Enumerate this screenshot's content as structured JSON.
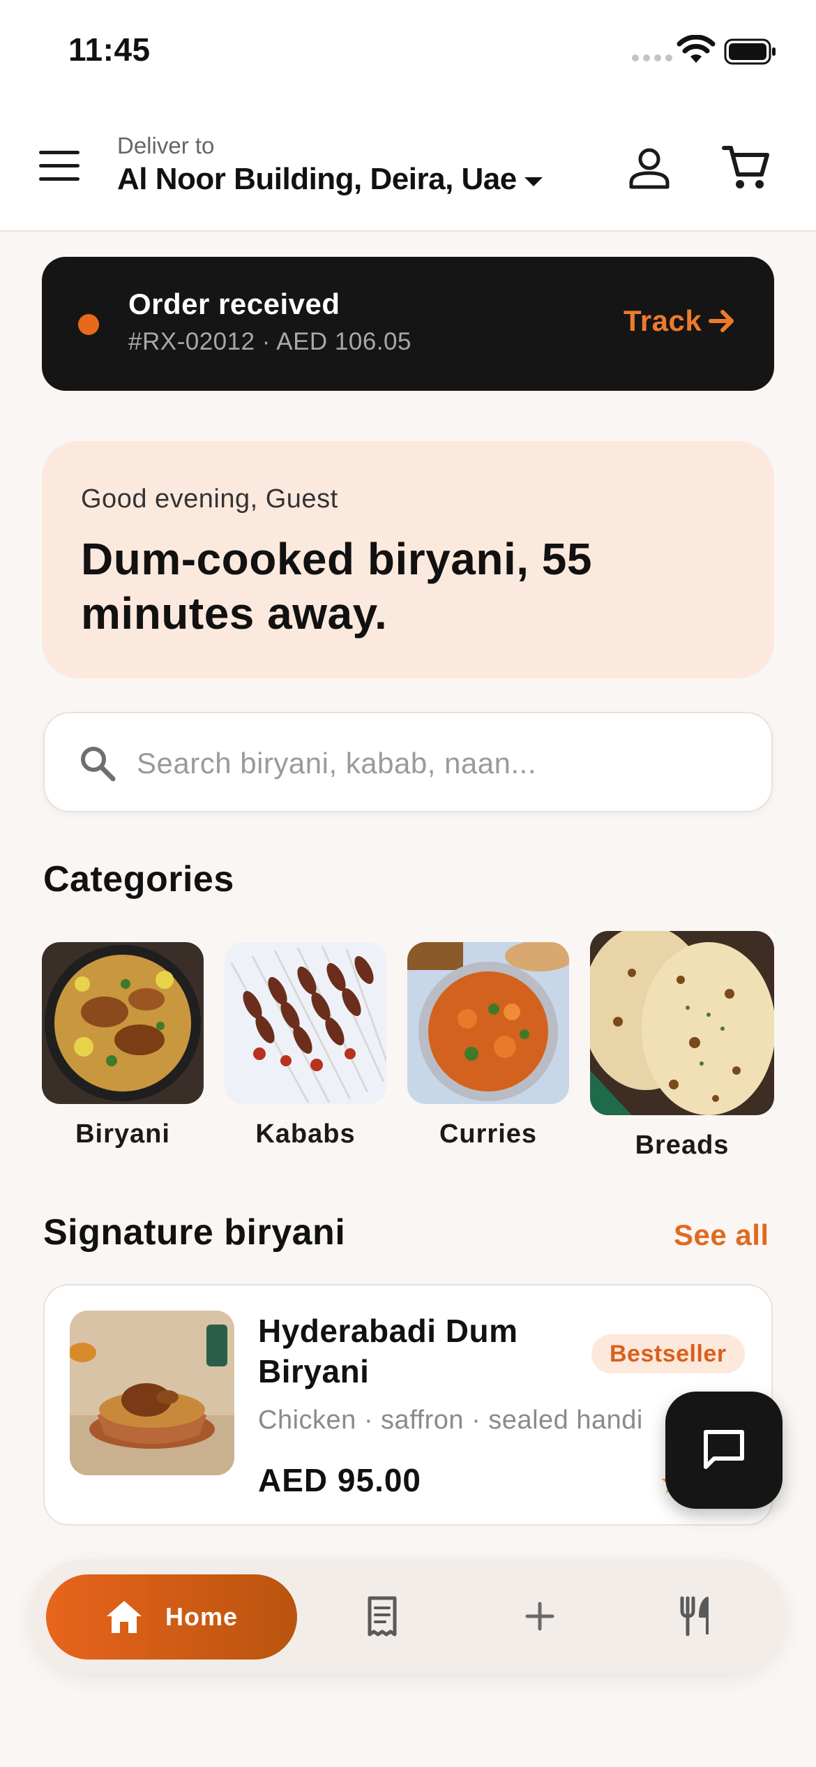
{
  "status_bar": {
    "time": "11:45"
  },
  "header": {
    "deliver_label": "Deliver to",
    "address": "Al Noor Building, Deira, Uae"
  },
  "order_banner": {
    "title": "Order received",
    "meta": "#RX-02012 · AED 106.05",
    "track_label": "Track",
    "status_color": "#e9691c"
  },
  "greeting": {
    "subtitle": "Good evening, Guest",
    "headline": "Dum-cooked biryani, 55 minutes away."
  },
  "search": {
    "placeholder": "Search biryani, kabab, naan..."
  },
  "categories": {
    "title": "Categories",
    "items": [
      {
        "label": "Biryani"
      },
      {
        "label": "Kababs"
      },
      {
        "label": "Curries"
      },
      {
        "label": "Breads"
      }
    ]
  },
  "signature": {
    "title": "Signature biryani",
    "see_all_label": "See all",
    "product": {
      "name": "Hyderabadi Dum Biryani",
      "badge": "Bestseller",
      "description": "Chicken · saffron · sealed handi",
      "price": "AED 95.00"
    }
  },
  "bottom_nav": {
    "home_label": "Home",
    "items": [
      "home-icon",
      "receipt-icon",
      "plus-icon",
      "utensils-icon"
    ]
  },
  "theme": {
    "accent": "#e8641c",
    "dark": "#151515",
    "background": "#faf6f3"
  }
}
